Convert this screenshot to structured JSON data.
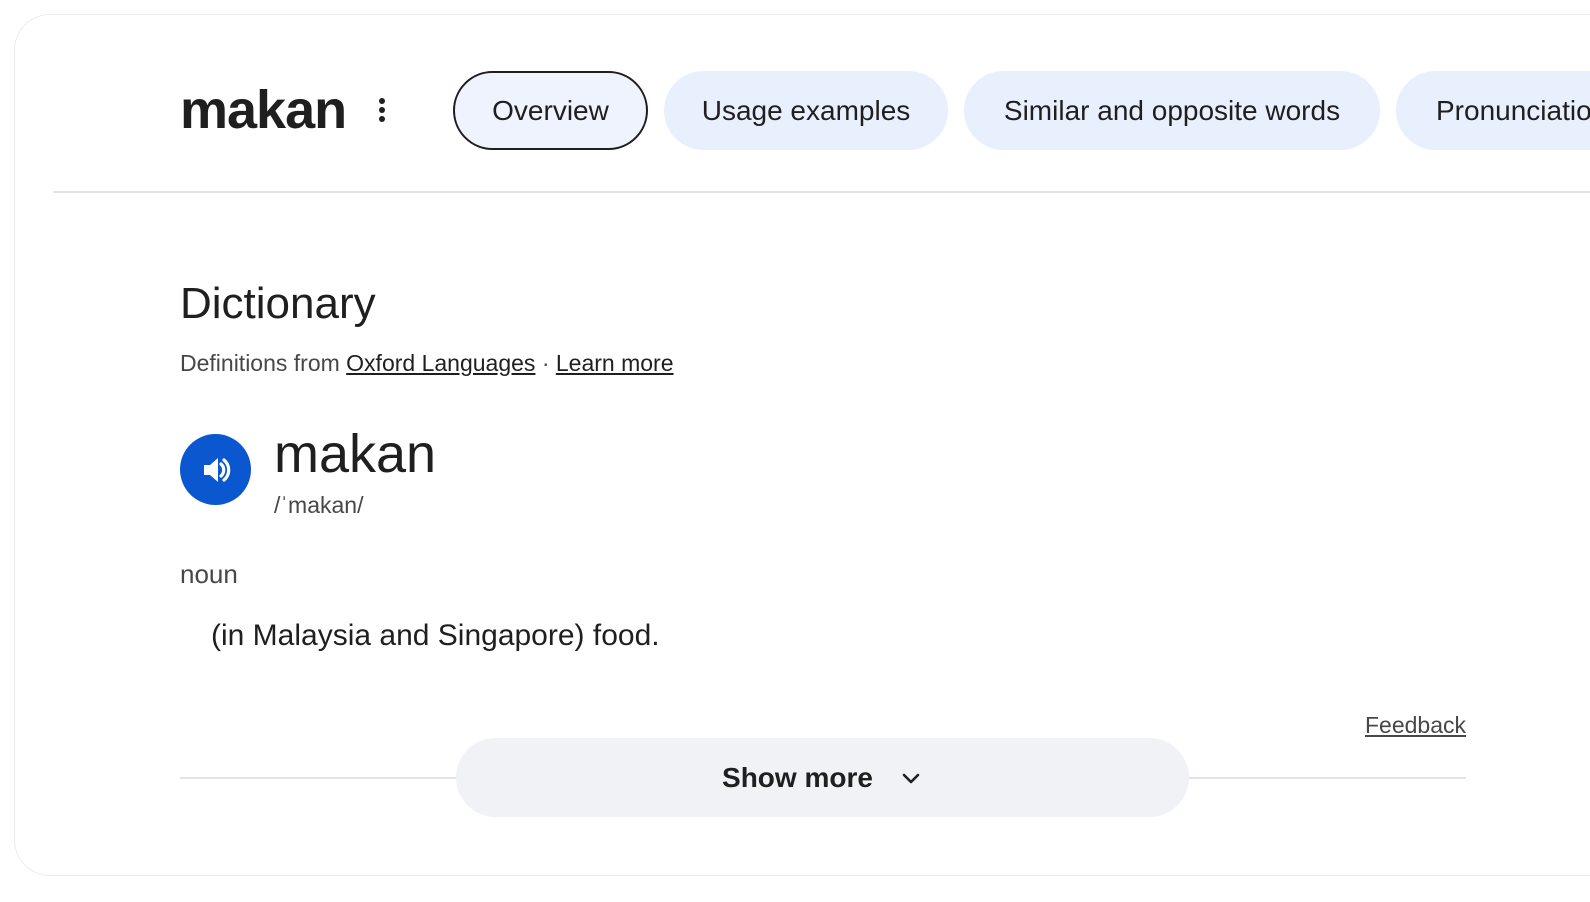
{
  "header": {
    "title": "makan",
    "more_icon": "more-vert-icon"
  },
  "tabs": [
    {
      "label": "Overview",
      "selected": true
    },
    {
      "label": "Usage examples",
      "selected": false
    },
    {
      "label": "Similar and opposite words",
      "selected": false
    },
    {
      "label": "Pronunciation",
      "selected": false
    }
  ],
  "dictionary": {
    "title": "Dictionary",
    "source_prefix": "Definitions from",
    "source_link": "Oxford Languages",
    "separator": "·",
    "learn_more": "Learn more",
    "headword": "makan",
    "phonetic": "/ˈmakan/",
    "speaker_icon": "volume-up-icon",
    "part_of_speech": "noun",
    "definition": "(in Malaysia and Singapore) food.",
    "feedback": "Feedback",
    "show_more": "Show more",
    "show_more_icon": "chevron-down-icon"
  },
  "colors": {
    "accent": "#0b57d0",
    "chip_bg": "#e8effd",
    "text": "#1f1f1f",
    "muted": "#474747"
  }
}
